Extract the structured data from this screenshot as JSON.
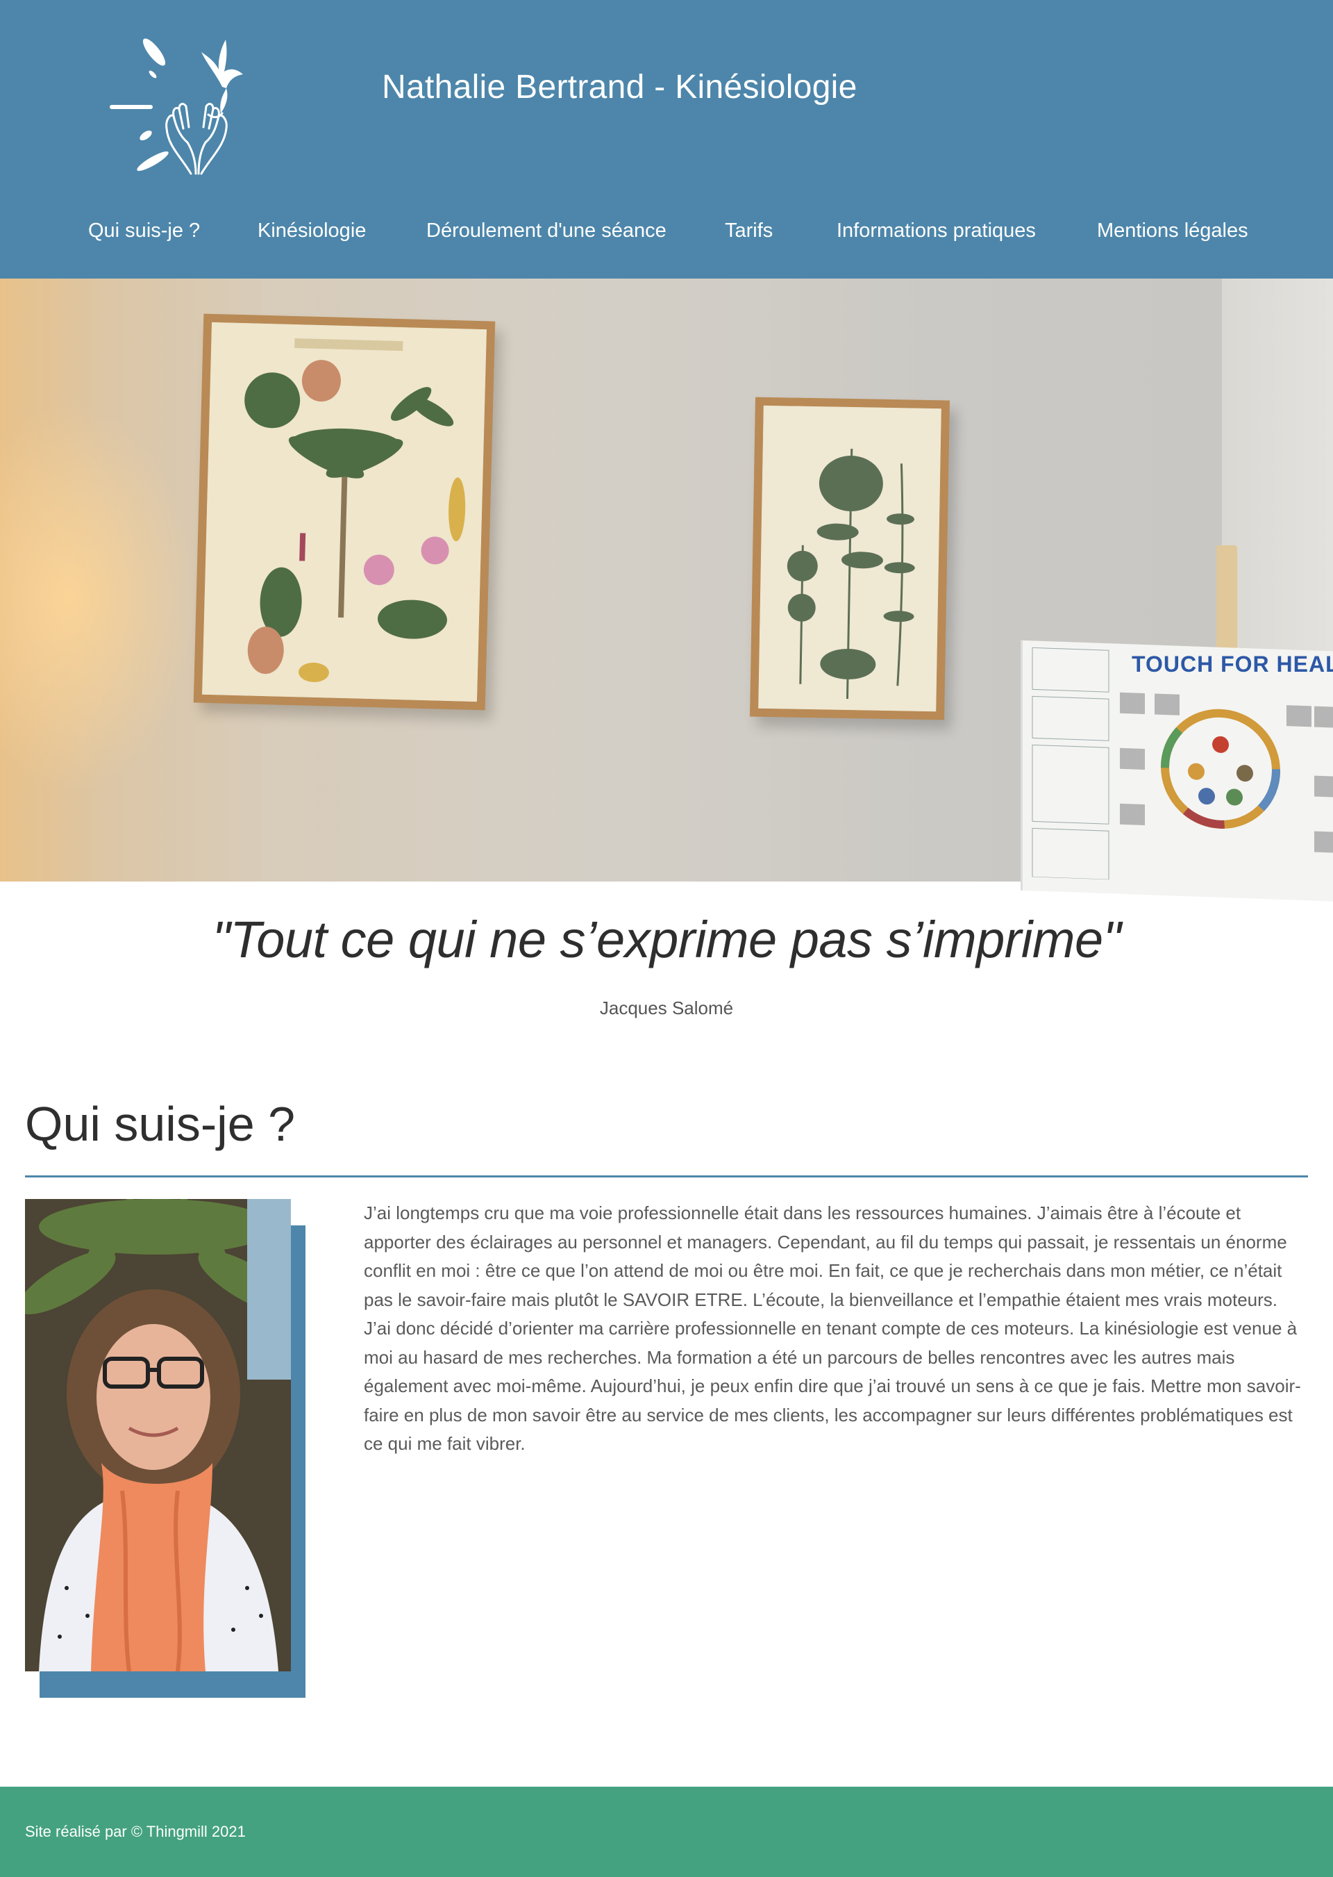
{
  "header": {
    "site_title": "Nathalie Bertrand - Kinésiologie",
    "logo_icon": "hands-bird-logo-icon"
  },
  "nav": {
    "items": [
      {
        "label": "Qui suis-je ?"
      },
      {
        "label": "Kinésiologie"
      },
      {
        "label": "Déroulement d'une séance"
      },
      {
        "label": "Tarifs"
      },
      {
        "label": "Informations pratiques"
      },
      {
        "label": "Mentions légales"
      }
    ]
  },
  "hero": {
    "board_text": "TOUCH FOR HEALTH"
  },
  "quote": {
    "text": "\"Tout ce qui ne s’exprime pas s’imprime\"",
    "author": "Jacques Salomé"
  },
  "about": {
    "title": "Qui suis-je ?",
    "bio": "J’ai longtemps cru que ma voie professionnelle était dans les ressources humaines. J’aimais être à l’écoute et apporter des éclairages au personnel et managers. Cependant, au fil du temps qui passait, je ressentais un énorme conflit en moi : être ce que l’on attend de moi ou être moi. En fait, ce que je recherchais dans mon métier, ce n’était pas le savoir-faire mais plutôt le SAVOIR ETRE. L’écoute, la bienveillance et l’empathie étaient mes vrais moteurs. J’ai donc décidé d’orienter ma carrière professionnelle en tenant compte de ces moteurs. La kinésiologie est venue à moi au hasard de mes recherches. Ma formation a été un parcours de belles rencontres avec les autres mais également avec moi-même. Aujourd’hui, je peux enfin dire que j’ai trouvé un sens à ce que je fais. Mettre mon savoir-faire en plus de mon savoir être au service de mes clients, les accompagner sur leurs différentes problématiques est ce qui me fait vibrer."
  },
  "footer": {
    "text": "Site réalisé par © Thingmill 2021"
  },
  "colors": {
    "header_bg": "#4d86aa",
    "footer_bg": "#44a281",
    "accent": "#4d86aa",
    "text": "#333333"
  }
}
